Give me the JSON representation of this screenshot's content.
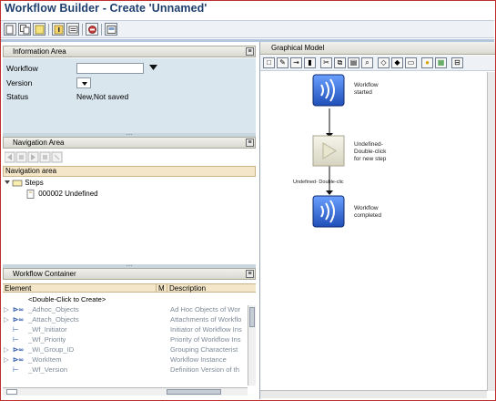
{
  "window": {
    "title": "Workflow Builder - Create 'Unnamed'"
  },
  "toolbar": {
    "buttons": [
      "new-doc-icon",
      "copy-icon",
      "highlight-icon",
      "info-icon",
      "settings-icon",
      "save-icon",
      "display-icon"
    ]
  },
  "info_area": {
    "title": "Information Area",
    "fields": {
      "workflow_label": "Workflow",
      "workflow_value": "",
      "version_label": "Version",
      "version_value": "",
      "status_label": "Status",
      "status_value": "New,Not saved"
    }
  },
  "nav_area": {
    "title": "Navigation Area",
    "header": "Navigation area",
    "tree": {
      "steps_label": "Steps",
      "item_label": "000002 Undefined"
    }
  },
  "container": {
    "title": "Workflow Container",
    "columns": [
      "Element",
      "M",
      "Description"
    ],
    "rows": [
      {
        "element": "<Double-Click to Create>",
        "m": "",
        "description": ""
      },
      {
        "element": "_Adhoc_Objects",
        "m": "",
        "description": "Ad Hoc Objects of Wor"
      },
      {
        "element": "_Attach_Objects",
        "m": "",
        "description": "Attachments of Workflo"
      },
      {
        "element": "_Wf_Initiator",
        "m": "",
        "description": "Initiator of Workflow Ins"
      },
      {
        "element": "_Wf_Priority",
        "m": "",
        "description": "Priority of Workflow Ins"
      },
      {
        "element": "_Wi_Group_ID",
        "m": "",
        "description": "Grouping Characterist"
      },
      {
        "element": "_WorkItem",
        "m": "",
        "description": "Workflow Instance"
      },
      {
        "element": "_Wf_Version",
        "m": "",
        "description": "Definition Version of th"
      }
    ]
  },
  "graphical_model": {
    "title": "Graphical Model",
    "nodes": {
      "start": "Workflow\nstarted",
      "undefined": "Undefined-\nDouble-click\nfor new step",
      "end": "Workflow\ncompleted"
    },
    "edge_label": "Undefined- Double-clic"
  },
  "colors": {
    "title": "#1f3f6e",
    "info_bg": "#d9e6ee",
    "grid_header": "#f4e6c8",
    "node_blue": "#2a5fd0"
  }
}
